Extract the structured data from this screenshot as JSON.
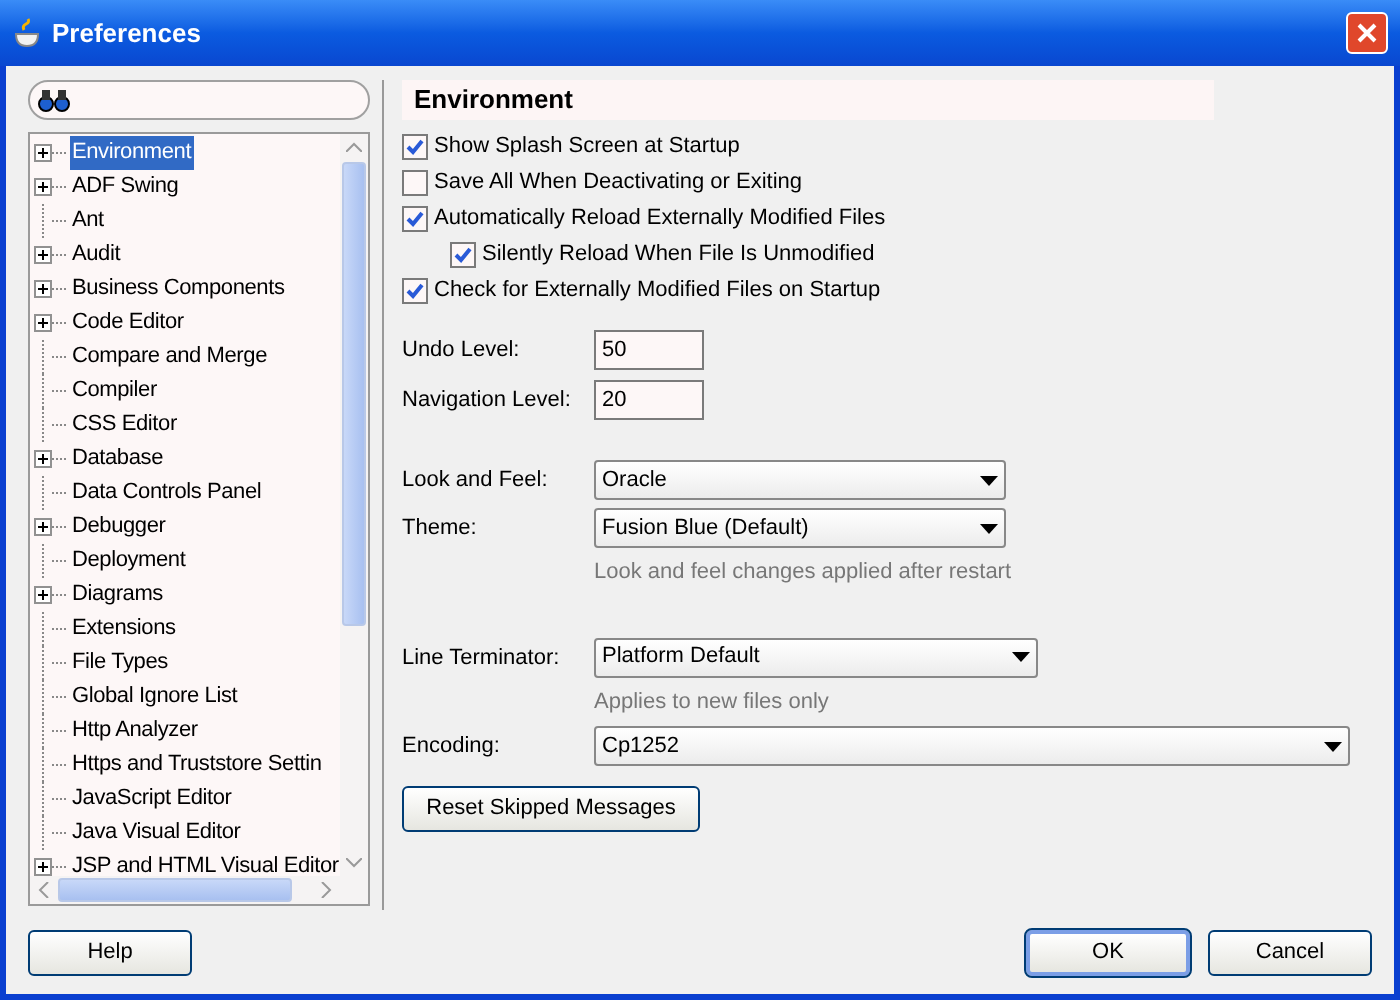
{
  "window": {
    "title": "Preferences"
  },
  "tree": {
    "items": [
      {
        "label": "Environment",
        "kind": "folder",
        "selected": true
      },
      {
        "label": "ADF Swing",
        "kind": "folder",
        "selected": false
      },
      {
        "label": "Ant",
        "kind": "leaf",
        "selected": false
      },
      {
        "label": "Audit",
        "kind": "folder",
        "selected": false
      },
      {
        "label": "Business Components",
        "kind": "folder",
        "selected": false
      },
      {
        "label": "Code Editor",
        "kind": "folder",
        "selected": false
      },
      {
        "label": "Compare and Merge",
        "kind": "leaf",
        "selected": false
      },
      {
        "label": "Compiler",
        "kind": "leaf",
        "selected": false
      },
      {
        "label": "CSS Editor",
        "kind": "leaf",
        "selected": false
      },
      {
        "label": "Database",
        "kind": "folder",
        "selected": false
      },
      {
        "label": "Data Controls Panel",
        "kind": "leaf",
        "selected": false
      },
      {
        "label": "Debugger",
        "kind": "folder",
        "selected": false
      },
      {
        "label": "Deployment",
        "kind": "leaf",
        "selected": false
      },
      {
        "label": "Diagrams",
        "kind": "folder",
        "selected": false
      },
      {
        "label": "Extensions",
        "kind": "leaf",
        "selected": false
      },
      {
        "label": "File Types",
        "kind": "leaf",
        "selected": false
      },
      {
        "label": "Global Ignore List",
        "kind": "leaf",
        "selected": false
      },
      {
        "label": "Http Analyzer",
        "kind": "leaf",
        "selected": false
      },
      {
        "label": "Https and Truststore Settin",
        "kind": "leaf",
        "selected": false
      },
      {
        "label": "JavaScript Editor",
        "kind": "leaf",
        "selected": false
      },
      {
        "label": "Java Visual Editor",
        "kind": "leaf",
        "selected": false
      },
      {
        "label": "JSP and HTML Visual Editor",
        "kind": "folder",
        "selected": false
      }
    ]
  },
  "panel": {
    "title": "Environment",
    "checkboxes": [
      {
        "label": "Show Splash Screen at Startup",
        "checked": true
      },
      {
        "label": "Save All When Deactivating or Exiting",
        "checked": false
      },
      {
        "label": "Automatically Reload Externally Modified Files",
        "checked": true,
        "children": [
          {
            "label": "Silently Reload When File Is Unmodified",
            "checked": true
          }
        ]
      },
      {
        "label": "Check for Externally Modified Files on Startup",
        "checked": true
      }
    ],
    "fields": [
      {
        "label": "Undo Level:",
        "value": "50"
      },
      {
        "label": "Navigation Level:",
        "value": "20"
      }
    ],
    "dropdowns": [
      {
        "label": "Look and Feel:",
        "value": "Oracle",
        "kind": "short"
      },
      {
        "label": "Theme:",
        "value": "Fusion Blue (Default)",
        "kind": "short",
        "hint": "Look and feel changes applied after restart"
      },
      {
        "label": "Line Terminator:",
        "value": "Platform Default",
        "kind": "medium",
        "hint": "Applies to new files only"
      },
      {
        "label": "Encoding:",
        "value": "Cp1252",
        "kind": "full"
      }
    ],
    "reset_button": "Reset Skipped Messages"
  },
  "help_button": "Help",
  "buttons": [
    {
      "label": "OK",
      "default": true
    },
    {
      "label": "Cancel",
      "default": false
    }
  ]
}
